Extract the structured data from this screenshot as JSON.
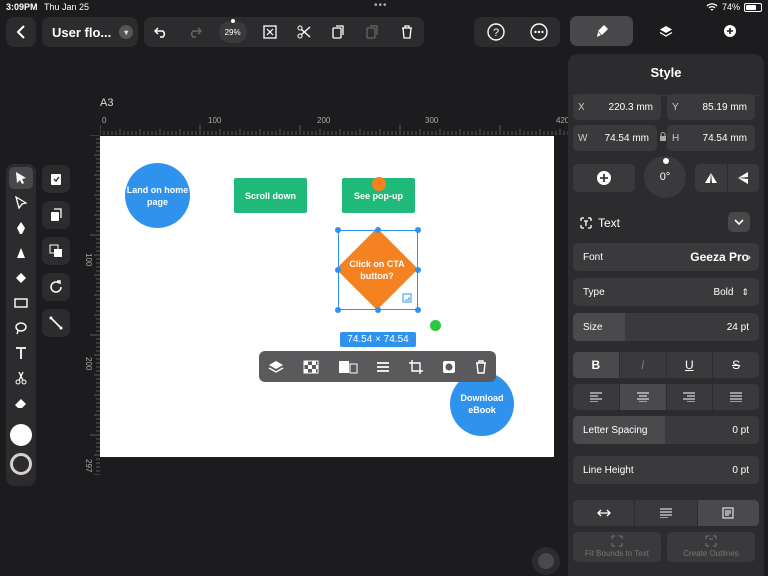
{
  "status": {
    "time": "3:09PM",
    "date": "Thu Jan 25",
    "battery": "74%",
    "battery_level": 0.74
  },
  "toolbar": {
    "doc_title": "User flo...",
    "zoom": "29%"
  },
  "canvas": {
    "artboard": "A3",
    "h_ticks": [
      "0",
      "100",
      "200",
      "300",
      "420"
    ],
    "v_ticks": [
      "100",
      "200",
      "297"
    ],
    "nodes": {
      "land": "Land on home page",
      "scroll": "Scroll down",
      "popup": "See pop-up",
      "cta": "Click on CTA button?",
      "download": "Download eBook"
    },
    "size_badge": "74.54 × 74.54"
  },
  "panel": {
    "title": "Style",
    "x_label": "X",
    "x_value": "220.3 mm",
    "y_label": "Y",
    "y_value": "85.19 mm",
    "w_label": "W",
    "w_value": "74.54 mm",
    "h_label": "H",
    "h_value": "74.54 mm",
    "rotation": "0°",
    "section_text": "Text",
    "font_label": "Font",
    "font_value": "Geeza Pro",
    "type_label": "Type",
    "type_value": "Bold",
    "size_label": "Size",
    "size_value": "24 pt",
    "style_buttons": [
      "B",
      "I",
      "U",
      "S"
    ],
    "letter_spacing_label": "Letter Spacing",
    "letter_spacing_value": "0 pt",
    "line_height_label": "Line Height",
    "line_height_value": "0 pt",
    "fit_bounds": "Fit Bounds to Text",
    "create_outlines": "Create Outlines"
  },
  "colors": {
    "accent": "#2f93ee",
    "node_green": "#1fb97a",
    "node_orange": "#f58220",
    "panel": "#2c2c2e"
  }
}
